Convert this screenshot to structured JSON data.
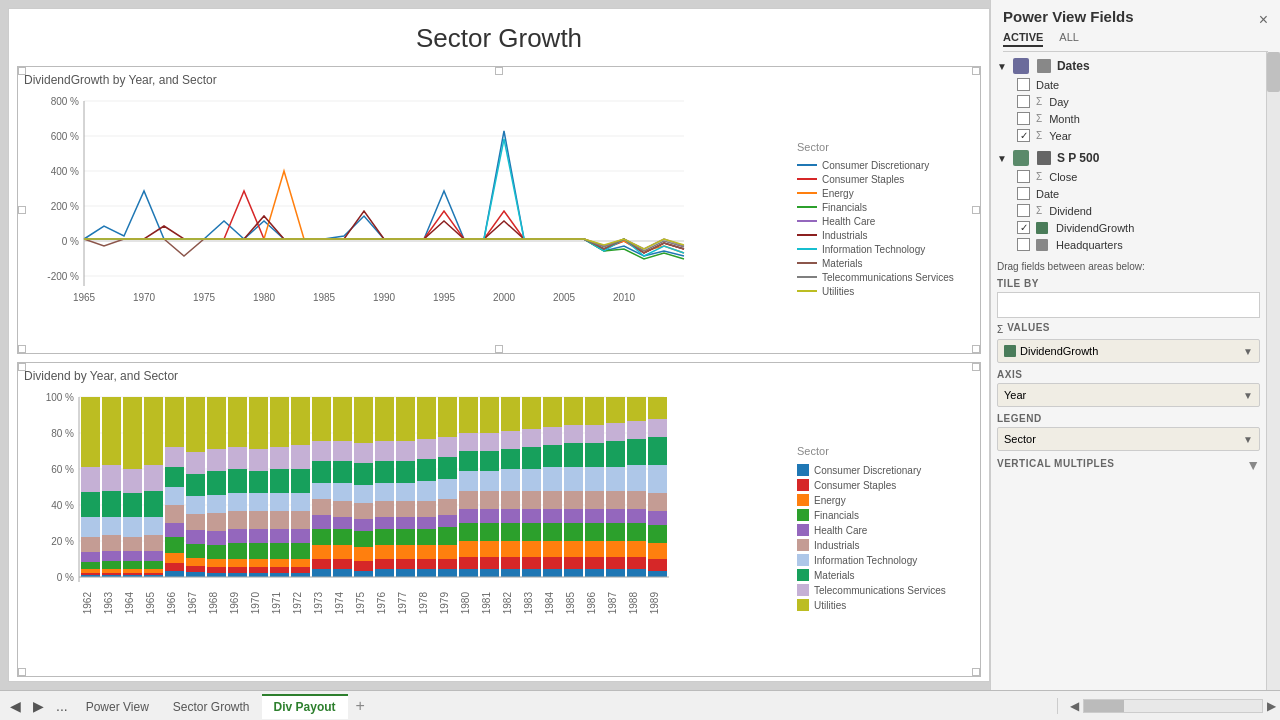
{
  "title": "Sector Growth",
  "chart1": {
    "title": "DividendGrowth by Year, and Sector",
    "yLabels": [
      "800 %",
      "600 %",
      "400 %",
      "200 %",
      "0 %",
      "-200 %"
    ],
    "xLabels": [
      "1965",
      "1970",
      "1975",
      "1980",
      "1985",
      "1990",
      "1995",
      "2000",
      "2005",
      "2010"
    ],
    "legendTitle": "Sector",
    "legend": [
      {
        "label": "Consumer Discretionary",
        "color": "#1f77b4"
      },
      {
        "label": "Consumer Staples",
        "color": "#d62728"
      },
      {
        "label": "Energy",
        "color": "#ff7f0e"
      },
      {
        "label": "Financials",
        "color": "#2ca02c"
      },
      {
        "label": "Health Care",
        "color": "#9467bd"
      },
      {
        "label": "Industrials",
        "color": "#d62728"
      },
      {
        "label": "Information Technology",
        "color": "#17becf"
      },
      {
        "label": "Materials",
        "color": "#8c564b"
      },
      {
        "label": "Telecommunications Services",
        "color": "#7f7f7f"
      },
      {
        "label": "Utilities",
        "color": "#bcbd22"
      }
    ]
  },
  "chart2": {
    "title": "Dividend by Year, and Sector",
    "yLabels": [
      "100 %",
      "80 %",
      "60 %",
      "40 %",
      "20 %",
      "0 %"
    ],
    "xLabels": [
      "1962",
      "1963",
      "1964",
      "1965",
      "1966",
      "1967",
      "1968",
      "1969",
      "1970",
      "1971",
      "1972",
      "1973",
      "1974",
      "1975",
      "1976",
      "1977",
      "1978",
      "1979",
      "1980",
      "1981",
      "1982",
      "1983",
      "1984",
      "1985",
      "1986",
      "1987",
      "1988",
      "1989"
    ],
    "legendTitle": "Sector",
    "legend": [
      {
        "label": "Consumer Discretionary",
        "color": "#1f77b4"
      },
      {
        "label": "Consumer Staples",
        "color": "#d62728"
      },
      {
        "label": "Energy",
        "color": "#ff7f0e"
      },
      {
        "label": "Financials",
        "color": "#2ca02c"
      },
      {
        "label": "Health Care",
        "color": "#9467bd"
      },
      {
        "label": "Industrials",
        "color": "#c49c94"
      },
      {
        "label": "Information Technology",
        "color": "#aec7e8"
      },
      {
        "label": "Materials",
        "color": "#17a05c"
      },
      {
        "label": "Telecommunications Services",
        "color": "#c5b0d5"
      },
      {
        "label": "Utilities",
        "color": "#bcbd22"
      }
    ]
  },
  "rightPanel": {
    "title": "Power View Fields",
    "closeLabel": "×",
    "tabs": [
      {
        "label": "ACTIVE",
        "active": true
      },
      {
        "label": "ALL",
        "active": false
      }
    ],
    "groups": [
      {
        "name": "Dates",
        "icon": "calendar",
        "expanded": true,
        "fields": [
          {
            "name": "Date",
            "checked": false,
            "type": "plain"
          },
          {
            "name": "Day",
            "checked": false,
            "type": "sigma"
          },
          {
            "name": "Month",
            "checked": false,
            "type": "sigma"
          },
          {
            "name": "Year",
            "checked": true,
            "type": "sigma"
          }
        ]
      },
      {
        "name": "S P 500",
        "icon": "table",
        "expanded": true,
        "fields": [
          {
            "name": "Close",
            "checked": false,
            "type": "sigma"
          },
          {
            "name": "Date",
            "checked": false,
            "type": "plain"
          },
          {
            "name": "Dividend",
            "checked": false,
            "type": "sigma"
          },
          {
            "name": "DividendGrowth",
            "checked": true,
            "type": "value"
          },
          {
            "name": "Headquarters",
            "checked": false,
            "type": "value"
          }
        ]
      }
    ],
    "dragLabel": "Drag fields between areas below:",
    "sections": [
      {
        "name": "TILE BY",
        "hasDropBox": true,
        "fields": []
      },
      {
        "name": "VALUES",
        "hasDropBox": false,
        "fields": [
          {
            "label": "DividendGrowth",
            "hasArrow": true
          }
        ]
      },
      {
        "name": "AXIS",
        "hasDropBox": false,
        "fields": [
          {
            "label": "Year",
            "hasArrow": true
          }
        ]
      },
      {
        "name": "LEGEND",
        "hasDropBox": false,
        "fields": [
          {
            "label": "Sector",
            "hasArrow": true
          }
        ]
      },
      {
        "name": "VERTICAL MULTIPLES",
        "hasDropBox": false,
        "fields": []
      }
    ]
  },
  "bottomTabs": {
    "items": [
      {
        "label": "Power View",
        "active": false
      },
      {
        "label": "Sector Growth",
        "active": false
      },
      {
        "label": "Div Payout",
        "active": true
      }
    ],
    "addLabel": "+"
  }
}
